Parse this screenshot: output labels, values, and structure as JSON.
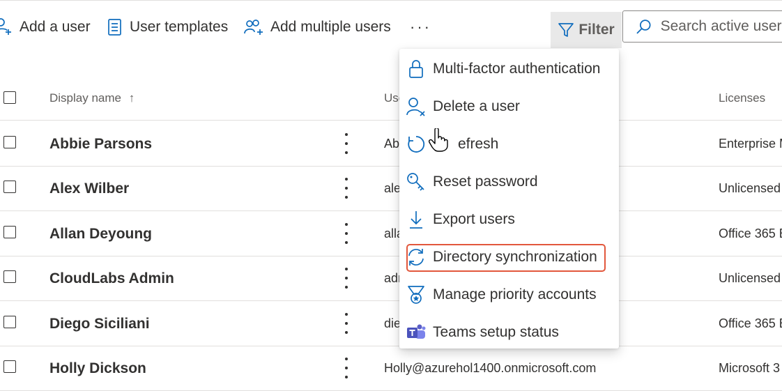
{
  "toolbar": {
    "add_user": "Add a user",
    "user_templates": "User templates",
    "add_multiple": "Add multiple users",
    "more": "···",
    "filter": "Filter",
    "search_placeholder": "Search active users"
  },
  "table": {
    "columns": {
      "display_name": "Display name",
      "sort_indicator": "↑",
      "username": "Use",
      "licenses": "Licenses"
    },
    "rows": [
      {
        "name": "Abbie Parsons",
        "upn": "Ab",
        "license": "Enterprise M"
      },
      {
        "name": "Alex Wilber",
        "upn": "ale",
        "license": "Unlicensed"
      },
      {
        "name": "Allan Deyoung",
        "upn": "alla",
        "license": "Office 365 E"
      },
      {
        "name": "CloudLabs Admin",
        "upn": "adr",
        "license": "Unlicensed"
      },
      {
        "name": "Diego Siciliani",
        "upn": "die",
        "license": "Office 365 E"
      },
      {
        "name": "Holly Dickson",
        "upn": "Holly@azurehol1400.onmicrosoft.com",
        "license": "Microsoft 3"
      }
    ]
  },
  "menu": {
    "items": [
      {
        "label": "Multi-factor authentication",
        "icon": "lock-icon"
      },
      {
        "label": "Delete a user",
        "icon": "delete-user-icon"
      },
      {
        "label": "efresh",
        "icon": "refresh-icon"
      },
      {
        "label": "Reset password",
        "icon": "key-icon"
      },
      {
        "label": "Export users",
        "icon": "download-icon"
      },
      {
        "label": "Directory synchronization",
        "icon": "sync-icon"
      },
      {
        "label": "Manage priority accounts",
        "icon": "priority-badge-icon"
      },
      {
        "label": "Teams setup status",
        "icon": "teams-icon"
      }
    ],
    "highlighted_item": "Directory synchronization"
  },
  "colors": {
    "accent": "#0f6cbd",
    "highlight_border": "#e2573c",
    "filter_bg": "#e9e9e9"
  }
}
